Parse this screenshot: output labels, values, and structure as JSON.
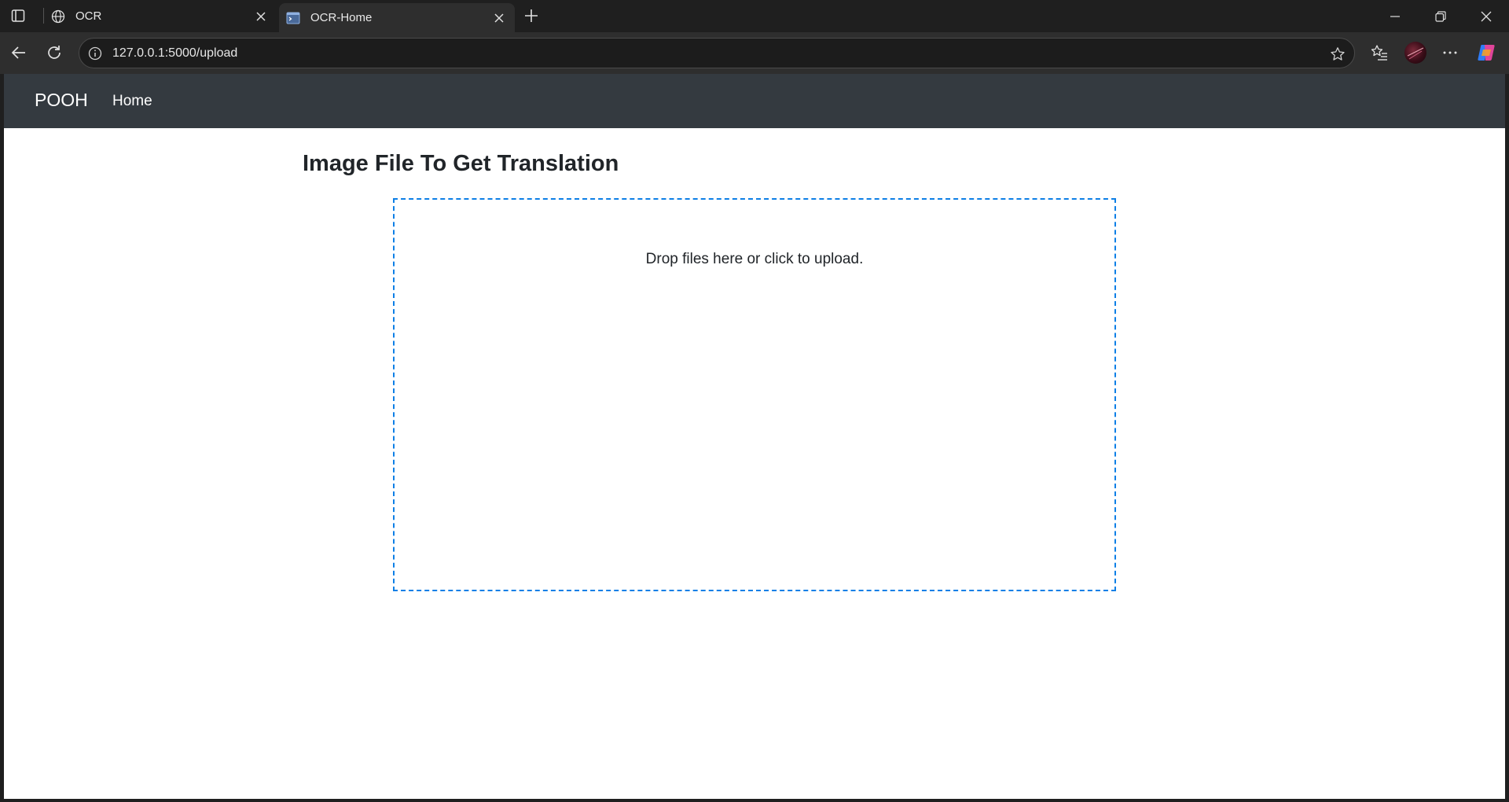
{
  "browser": {
    "tabs": [
      {
        "title": "OCR",
        "icon": "globe-icon",
        "active": false
      },
      {
        "title": "OCR-Home",
        "icon": "terminal-window-icon",
        "active": true
      }
    ],
    "address": {
      "url": "127.0.0.1:5000/upload"
    }
  },
  "navbar": {
    "brand": "POOH",
    "links": [
      "Home"
    ]
  },
  "main": {
    "title": "Image File To Get Translation",
    "dropzone": {
      "message": "Drop files here or click to upload."
    }
  },
  "colors": {
    "navbar_bg": "#343a40",
    "dropzone_border": "#0d7fe6",
    "browser_chrome": "#1f1f1f"
  }
}
